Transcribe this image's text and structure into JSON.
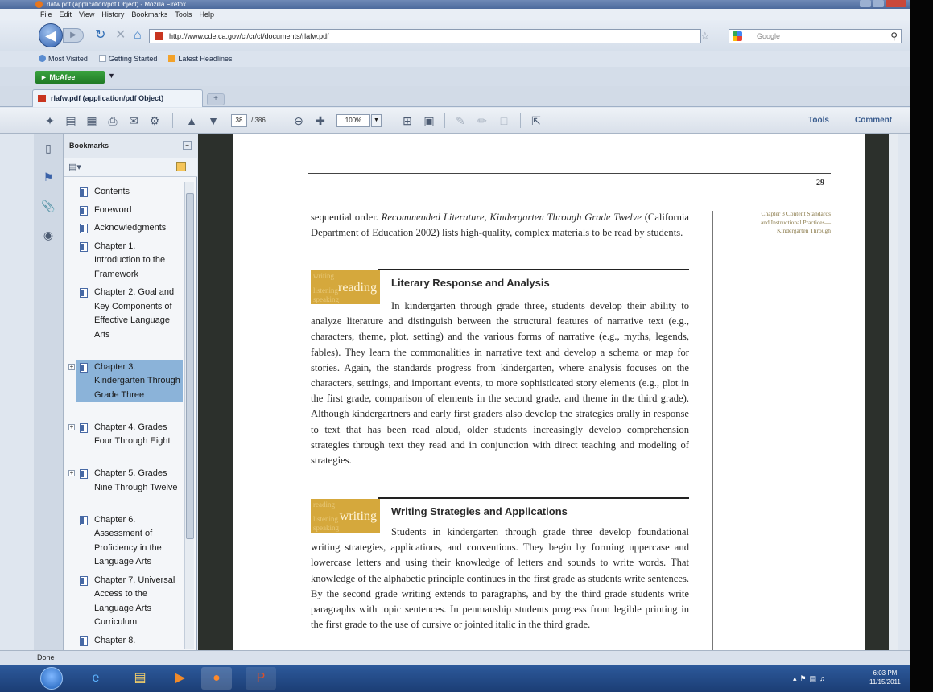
{
  "window": {
    "title": "rlafw.pdf (application/pdf Object) - Mozilla Firefox"
  },
  "menu": {
    "items": [
      "File",
      "Edit",
      "View",
      "History",
      "Bookmarks",
      "Tools",
      "Help"
    ]
  },
  "nav": {
    "url": "http://www.cde.ca.gov/ci/cr/cf/documents/rlafw.pdf",
    "search_placeholder": "Google"
  },
  "bookmarks_bar": {
    "items": [
      "Most Visited",
      "Getting Started",
      "Latest Headlines"
    ]
  },
  "toolbar_addon": {
    "mcafee_label": "McAfee"
  },
  "tabs": {
    "active_label": "rlafw.pdf (application/pdf Object)",
    "new_tab_label": "+"
  },
  "pdf_toolbar": {
    "page_current": "38",
    "page_total": "/ 386",
    "zoom": "100%",
    "tools_label": "Tools",
    "comment_label": "Comment"
  },
  "bookmarks_panel": {
    "title": "Bookmarks",
    "items": [
      {
        "label": "Contents",
        "expandable": false,
        "selected": false
      },
      {
        "label": "Foreword",
        "expandable": false,
        "selected": false
      },
      {
        "label": "Acknowledgments",
        "expandable": false,
        "selected": false
      },
      {
        "label": "Chapter 1. Introduction to the Framework",
        "expandable": false,
        "selected": false
      },
      {
        "label": "Chapter 2. Goal and Key Components of Effective Language Arts",
        "expandable": false,
        "selected": false
      },
      {
        "label": "Chapter 3. Kindergarten Through Grade Three",
        "expandable": true,
        "selected": true
      },
      {
        "label": "Chapter 4. Grades Four Through Eight",
        "expandable": true,
        "selected": false
      },
      {
        "label": "Chapter 5. Grades Nine Through Twelve",
        "expandable": true,
        "selected": false
      },
      {
        "label": "Chapter 6. Assessment of Proficiency in the Language Arts",
        "expandable": false,
        "selected": false
      },
      {
        "label": "Chapter 7. Universal Access to the Language Arts Curriculum",
        "expandable": false,
        "selected": false
      },
      {
        "label": "Chapter 8. Responsibilities",
        "expandable": false,
        "selected": false
      }
    ]
  },
  "document": {
    "page_number": "29",
    "side_note": "Chapter 3 Content Standards and Instructional Practices— Kindergarten Through",
    "intro_part1": "sequential order. ",
    "intro_italic": "Recommended Literature, Kindergarten Through Grade Twelve",
    "intro_part2": " (California Department of Education 2002) lists high-quality, complex materials to be read by students.",
    "section1": {
      "badge_main": "reading",
      "badge_ghost": [
        "writing",
        "listening",
        "speaking"
      ],
      "heading": "Literary Response and Analysis",
      "body": "In kindergarten through grade three, students develop their ability to analyze literature and distinguish between the structural features of narrative text (e.g., characters, theme, plot, setting) and the various forms of narrative (e.g., myths, legends, fables). They learn the commonalities in narrative text and develop a schema or map for stories. Again, the standards progress from kindergarten, where analysis focuses on the characters, settings, and important events, to more sophisticated story elements (e.g., plot in the first grade, comparison of elements in the second grade, and theme in the third grade). Although kindergartners and early first graders also develop the strategies orally in response to text that has been read aloud, older students increasingly develop comprehension strategies through text they read and in conjunction with direct teaching and modeling of strategies."
    },
    "section2": {
      "badge_main": "writing",
      "badge_ghost": [
        "reading",
        "listening",
        "speaking"
      ],
      "heading": "Writing Strategies and Applications",
      "body": "Students in kindergarten through grade three develop foundational writing strategies, applications, and conventions. They begin by forming uppercase and lowercase letters and using their knowledge of letters and sounds to write words. That knowledge of the alphabetic principle continues in the first grade as students write sentences. By the second grade writing extends to paragraphs, and by the third grade students write paragraphs with topic sentences. In penmanship students progress from legible printing in the first grade to the use of cursive or jointed italic in the third grade."
    }
  },
  "status": {
    "text": "Done"
  },
  "taskbar": {
    "time": "6:03 PM",
    "date": "11/15/2011"
  }
}
